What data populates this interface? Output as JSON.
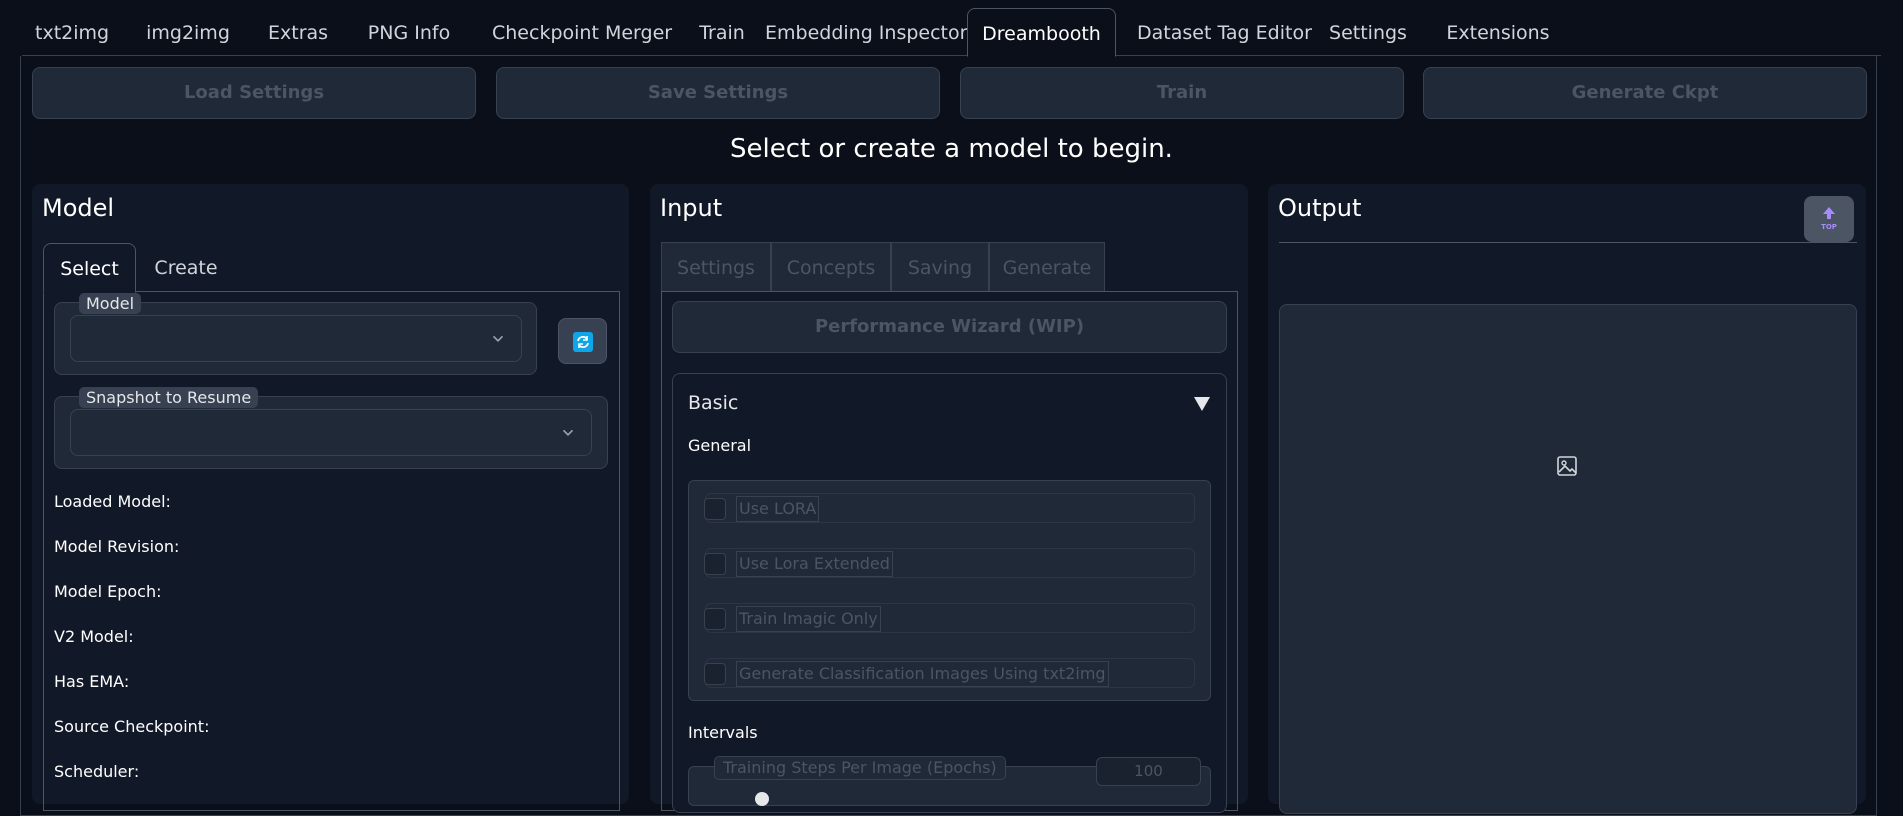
{
  "nav": {
    "tabs": [
      {
        "label": "txt2img"
      },
      {
        "label": "img2img"
      },
      {
        "label": "Extras"
      },
      {
        "label": "PNG Info"
      },
      {
        "label": "Checkpoint Merger"
      },
      {
        "label": "Train"
      },
      {
        "label": "Embedding Inspector"
      },
      {
        "label": "Dreambooth",
        "active": true
      },
      {
        "label": "Dataset Tag Editor"
      },
      {
        "label": "Settings"
      },
      {
        "label": "Extensions"
      }
    ]
  },
  "toolbar": {
    "load_settings": "Load Settings",
    "save_settings": "Save Settings",
    "train": "Train",
    "generate_ckpt": "Generate Ckpt"
  },
  "status_message": "Select or create a model to begin.",
  "model_panel": {
    "title": "Model",
    "tabs": {
      "select": "Select",
      "create": "Create"
    },
    "model_label": "Model",
    "model_value": "",
    "snapshot_label": "Snapshot to Resume",
    "snapshot_value": "",
    "info": {
      "loaded_model": "Loaded Model:",
      "model_revision": "Model Revision:",
      "model_epoch": "Model Epoch:",
      "v2_model": "V2 Model:",
      "has_ema": "Has EMA:",
      "source_checkpoint": "Source Checkpoint:",
      "scheduler": "Scheduler:"
    },
    "refresh_icon": "refresh-icon"
  },
  "input_panel": {
    "title": "Input",
    "tabs": {
      "settings": "Settings",
      "concepts": "Concepts",
      "saving": "Saving",
      "generate": "Generate"
    },
    "wizard_button": "Performance Wizard (WIP)",
    "basic": {
      "title": "Basic",
      "collapse_icon": "triangle-down-icon",
      "general_label": "General",
      "checkboxes": {
        "use_lora": "Use LORA",
        "use_lora_extended": "Use Lora Extended",
        "train_imagic_only": "Train Imagic Only",
        "generate_classification": "Generate Classification Images Using txt2img"
      },
      "intervals_label": "Intervals",
      "steps_label": "Training Steps Per Image (Epochs)",
      "steps_value": "100"
    }
  },
  "output_panel": {
    "title": "Output",
    "image_placeholder_icon": "image-icon",
    "top_button_icon": "scroll-top-icon",
    "top_button_text": "TOP"
  },
  "colors": {
    "background": "#0b0f19",
    "panel": "#111827",
    "field": "#1f2937",
    "border": "#374151",
    "accent": "#0ea5e9"
  }
}
